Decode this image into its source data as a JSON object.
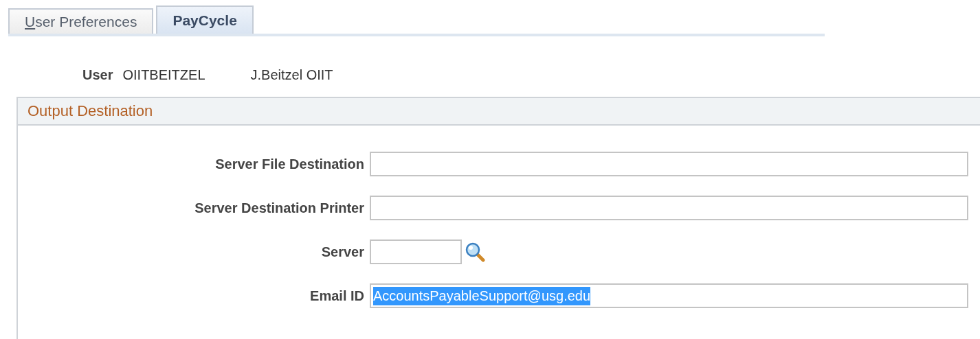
{
  "tabs": [
    {
      "label": "User Preferences",
      "access_key_underlined": true,
      "selected": false
    },
    {
      "label": "PayCycle",
      "selected": true
    }
  ],
  "user": {
    "label": "User",
    "id": "OIITBEITZEL",
    "name": "J.Beitzel OIIT"
  },
  "section": {
    "title": "Output Destination",
    "fields": [
      {
        "kind": "text",
        "label": "Server File Destination"
      },
      {
        "kind": "text",
        "label": "Server Destination Printer"
      },
      {
        "kind": "lookup",
        "label": "Server"
      },
      {
        "kind": "text",
        "label": "Email ID",
        "value": "AccountsPayableSupport@usg.edu",
        "highlighted": true
      }
    ]
  }
}
